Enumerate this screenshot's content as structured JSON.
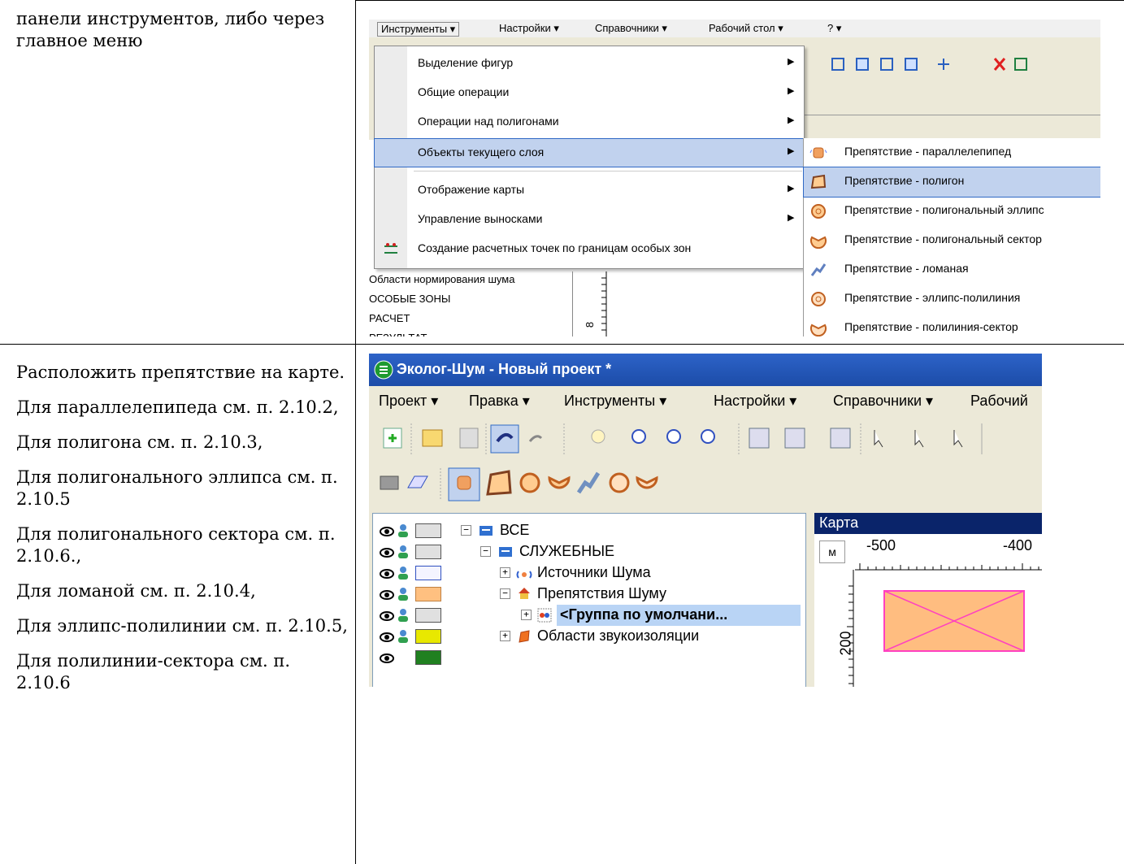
{
  "doc": {
    "top_text": "панели инструментов, либо через главное меню",
    "paragraphs": [
      "Расположить препятствие на карте.",
      "Для параллелепипеда см. п. 2.10.2,",
      "Для полигона см. п. 2.10.3,",
      "Для полигонального эллипса см. п. 2.10.5",
      "Для полигонального сектора см. п. 2.10.6.,",
      "Для ломаной см. п. 2.10.4,",
      "Для эллипс-полилинии см. п. 2.10.5,",
      "Для полилинии-сектора см. п. 2.10.6"
    ]
  },
  "shot1": {
    "menubar": [
      "Инструменты ▾",
      "Настройки ▾",
      "Справочники ▾",
      "Рабочий стол ▾",
      "? ▾"
    ],
    "menu_items": [
      {
        "label": "Выделение фигур"
      },
      {
        "label": "Общие операции"
      },
      {
        "label": "Операции над полигонами"
      },
      {
        "label": "Объекты текущего слоя"
      },
      {
        "label": "Отображение карты"
      },
      {
        "label": "Управление выносками"
      },
      {
        "label": "Создание расчетных точек по границам особых зон"
      }
    ],
    "submenu_items": [
      {
        "label": "Препятствие - параллелепипед"
      },
      {
        "label": "Препятствие - полигон"
      },
      {
        "label": "Препятствие - полигональный эллипс"
      },
      {
        "label": "Препятствие - полигональный сектор"
      },
      {
        "label": "Препятствие - ломаная"
      },
      {
        "label": "Препятствие - эллипс-полилиния"
      },
      {
        "label": "Препятствие - полилиния-сектор"
      }
    ],
    "layers": [
      "Области нормирования шума",
      "ОСОБЫЕ ЗОНЫ",
      "РАСЧЕТ",
      "РЕЗУЛЬТАТ"
    ],
    "ruler_label": "8"
  },
  "shot2": {
    "title": "Эколог-Шум - Новый проект *",
    "menubar": [
      "Проект ▾",
      "Правка ▾",
      "Инструменты ▾",
      "Настройки ▾",
      "Справочники ▾",
      "Рабочий"
    ],
    "tree": [
      {
        "label": "ВСЕ",
        "swatch": "#e0e0e0"
      },
      {
        "label": "СЛУЖЕБНЫЕ",
        "swatch": "#e0e0e0"
      },
      {
        "label": "Источники Шума",
        "swatch": "#f4f4ff"
      },
      {
        "label": "Препятствия Шуму",
        "swatch": "#ffc080"
      },
      {
        "label": "<Группа по умолчани...",
        "swatch": "#e0e0e0"
      },
      {
        "label": "Области звукоизоляции",
        "swatch": "#e8e800"
      }
    ],
    "map": {
      "title": "Карта",
      "unit": "м",
      "x_ticks": [
        "-500",
        "-400"
      ],
      "y_tick": "200",
      "obstacle_fill": "#ffbd80",
      "obstacle_stroke": "#ff40c0"
    }
  }
}
